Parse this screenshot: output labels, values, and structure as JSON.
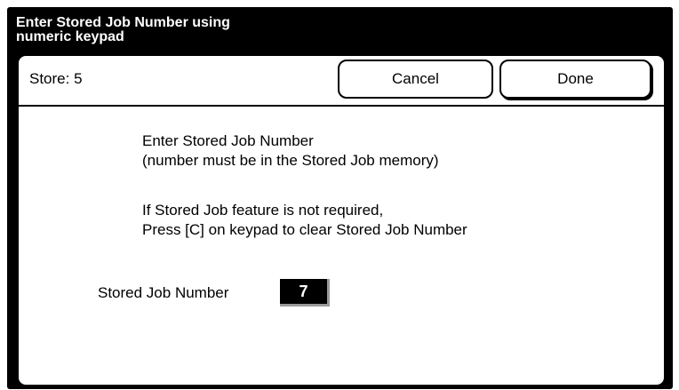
{
  "title": "Enter Stored Job Number using\nnumeric keypad",
  "header": {
    "store_label": "Store: 5",
    "cancel_label": "Cancel",
    "done_label": "Done"
  },
  "messages": {
    "line1": "Enter Stored Job Number",
    "line2": "(number must be in the Stored Job memory)",
    "line3": "If Stored Job feature is not required,",
    "line4": "Press [C] on keypad to clear Stored Job Number"
  },
  "field": {
    "label": "Stored Job Number",
    "value": "7"
  }
}
